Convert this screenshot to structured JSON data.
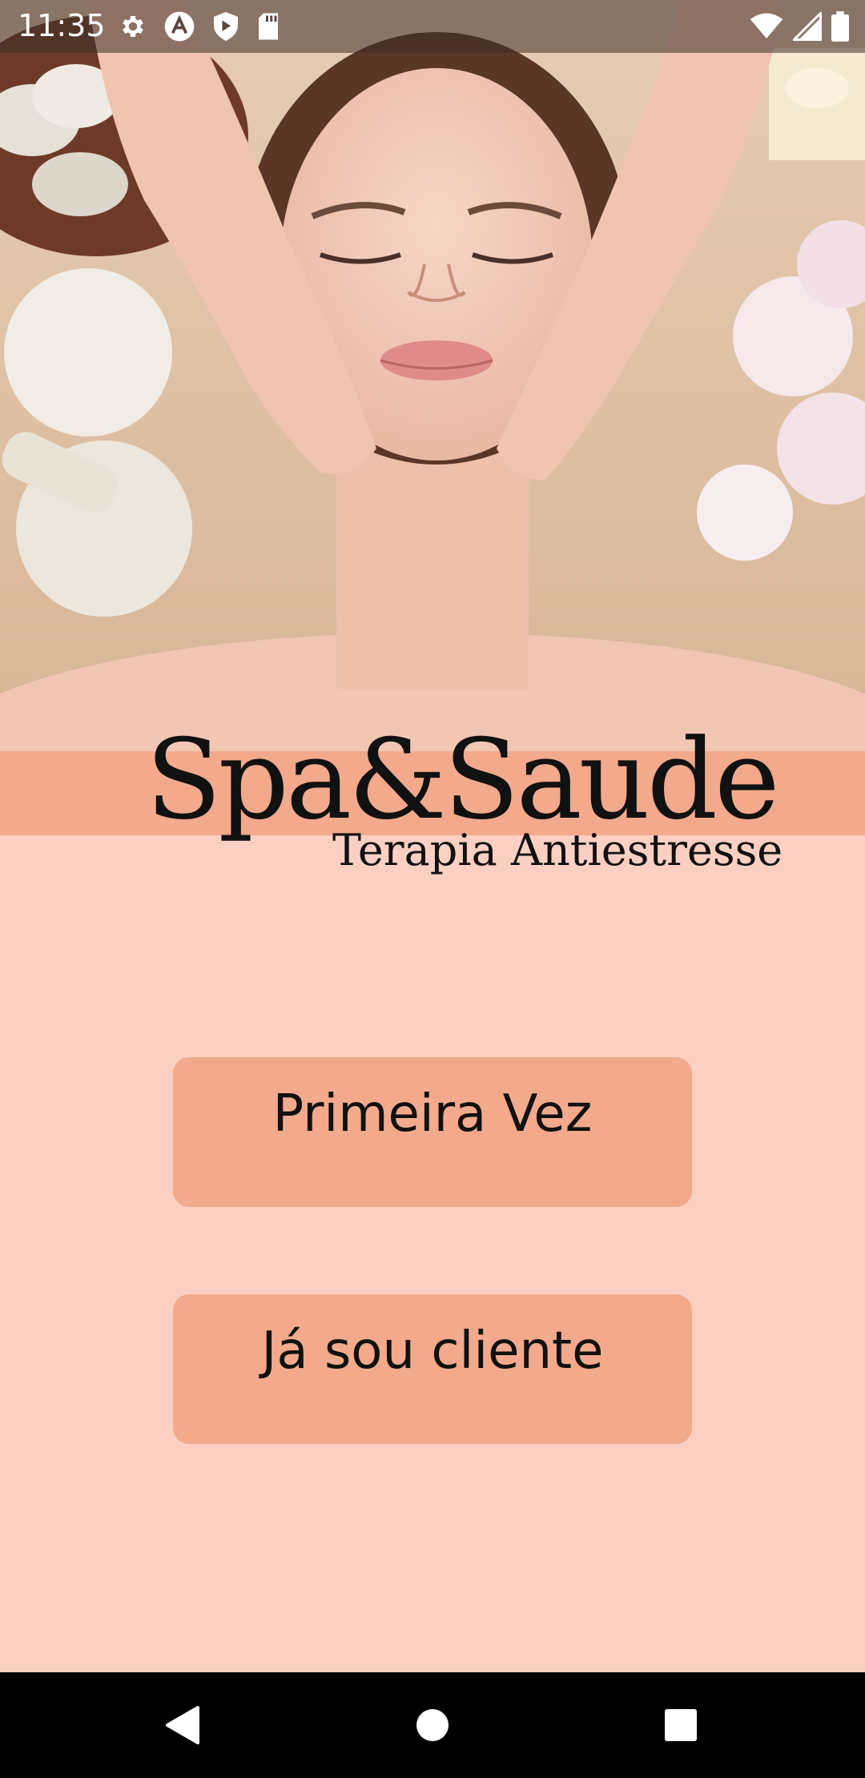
{
  "status_bar": {
    "time": "11:35",
    "left_icons": [
      "settings-icon",
      "app-a-icon",
      "shield-play-icon",
      "sd-card-icon"
    ],
    "right_icons": [
      "wifi-icon",
      "signal-icon",
      "battery-icon"
    ]
  },
  "hero": {
    "image": "spa-facial-massage-photo"
  },
  "logo": {
    "title": "Spa&Saude",
    "subtitle": "Terapia Antiestresse"
  },
  "buttons": {
    "first_time": "Primeira Vez",
    "existing_client": "Já sou cliente"
  },
  "nav_bar": {
    "icons": [
      "back-icon",
      "home-icon",
      "recents-icon"
    ]
  },
  "colors": {
    "background": "#fbd0c2",
    "accent": "#f2a98c",
    "text": "#111111"
  }
}
